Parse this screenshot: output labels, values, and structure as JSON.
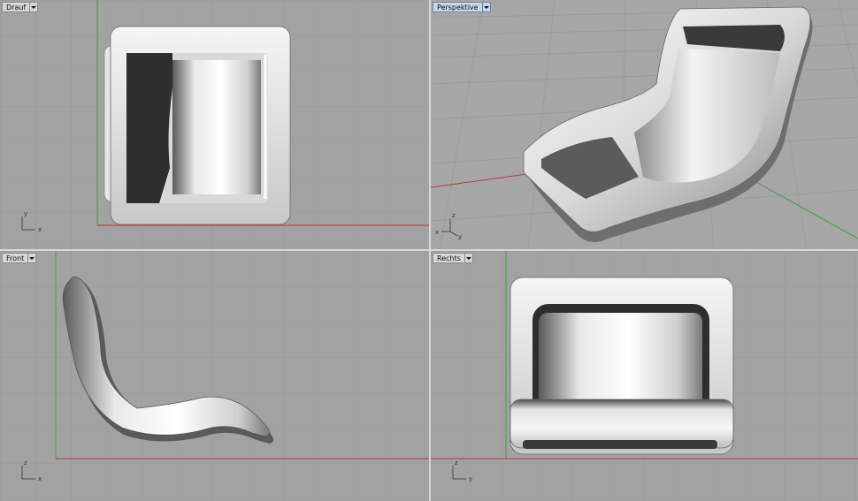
{
  "viewports": {
    "top": {
      "label": "Drauf",
      "axis_a": "y",
      "axis_b": "x",
      "active": false
    },
    "perspective": {
      "label": "Perspektive",
      "axis_a": "z",
      "axis_b": "x",
      "axis_c": "y",
      "active": true
    },
    "front": {
      "label": "Front",
      "axis_a": "z",
      "axis_b": "x",
      "active": false
    },
    "right": {
      "label": "Rechts",
      "axis_a": "z",
      "axis_b": "y",
      "active": false
    }
  },
  "colors": {
    "viewport_bg": "#a2a2a2",
    "grid_line": "#929292",
    "x_axis": "#b23a3a",
    "y_axis": "#3fa03f",
    "active_label": "#c7d6ec"
  },
  "icons": [
    "viewport-menu-dropdown-icon",
    "axis-triad-icon"
  ]
}
